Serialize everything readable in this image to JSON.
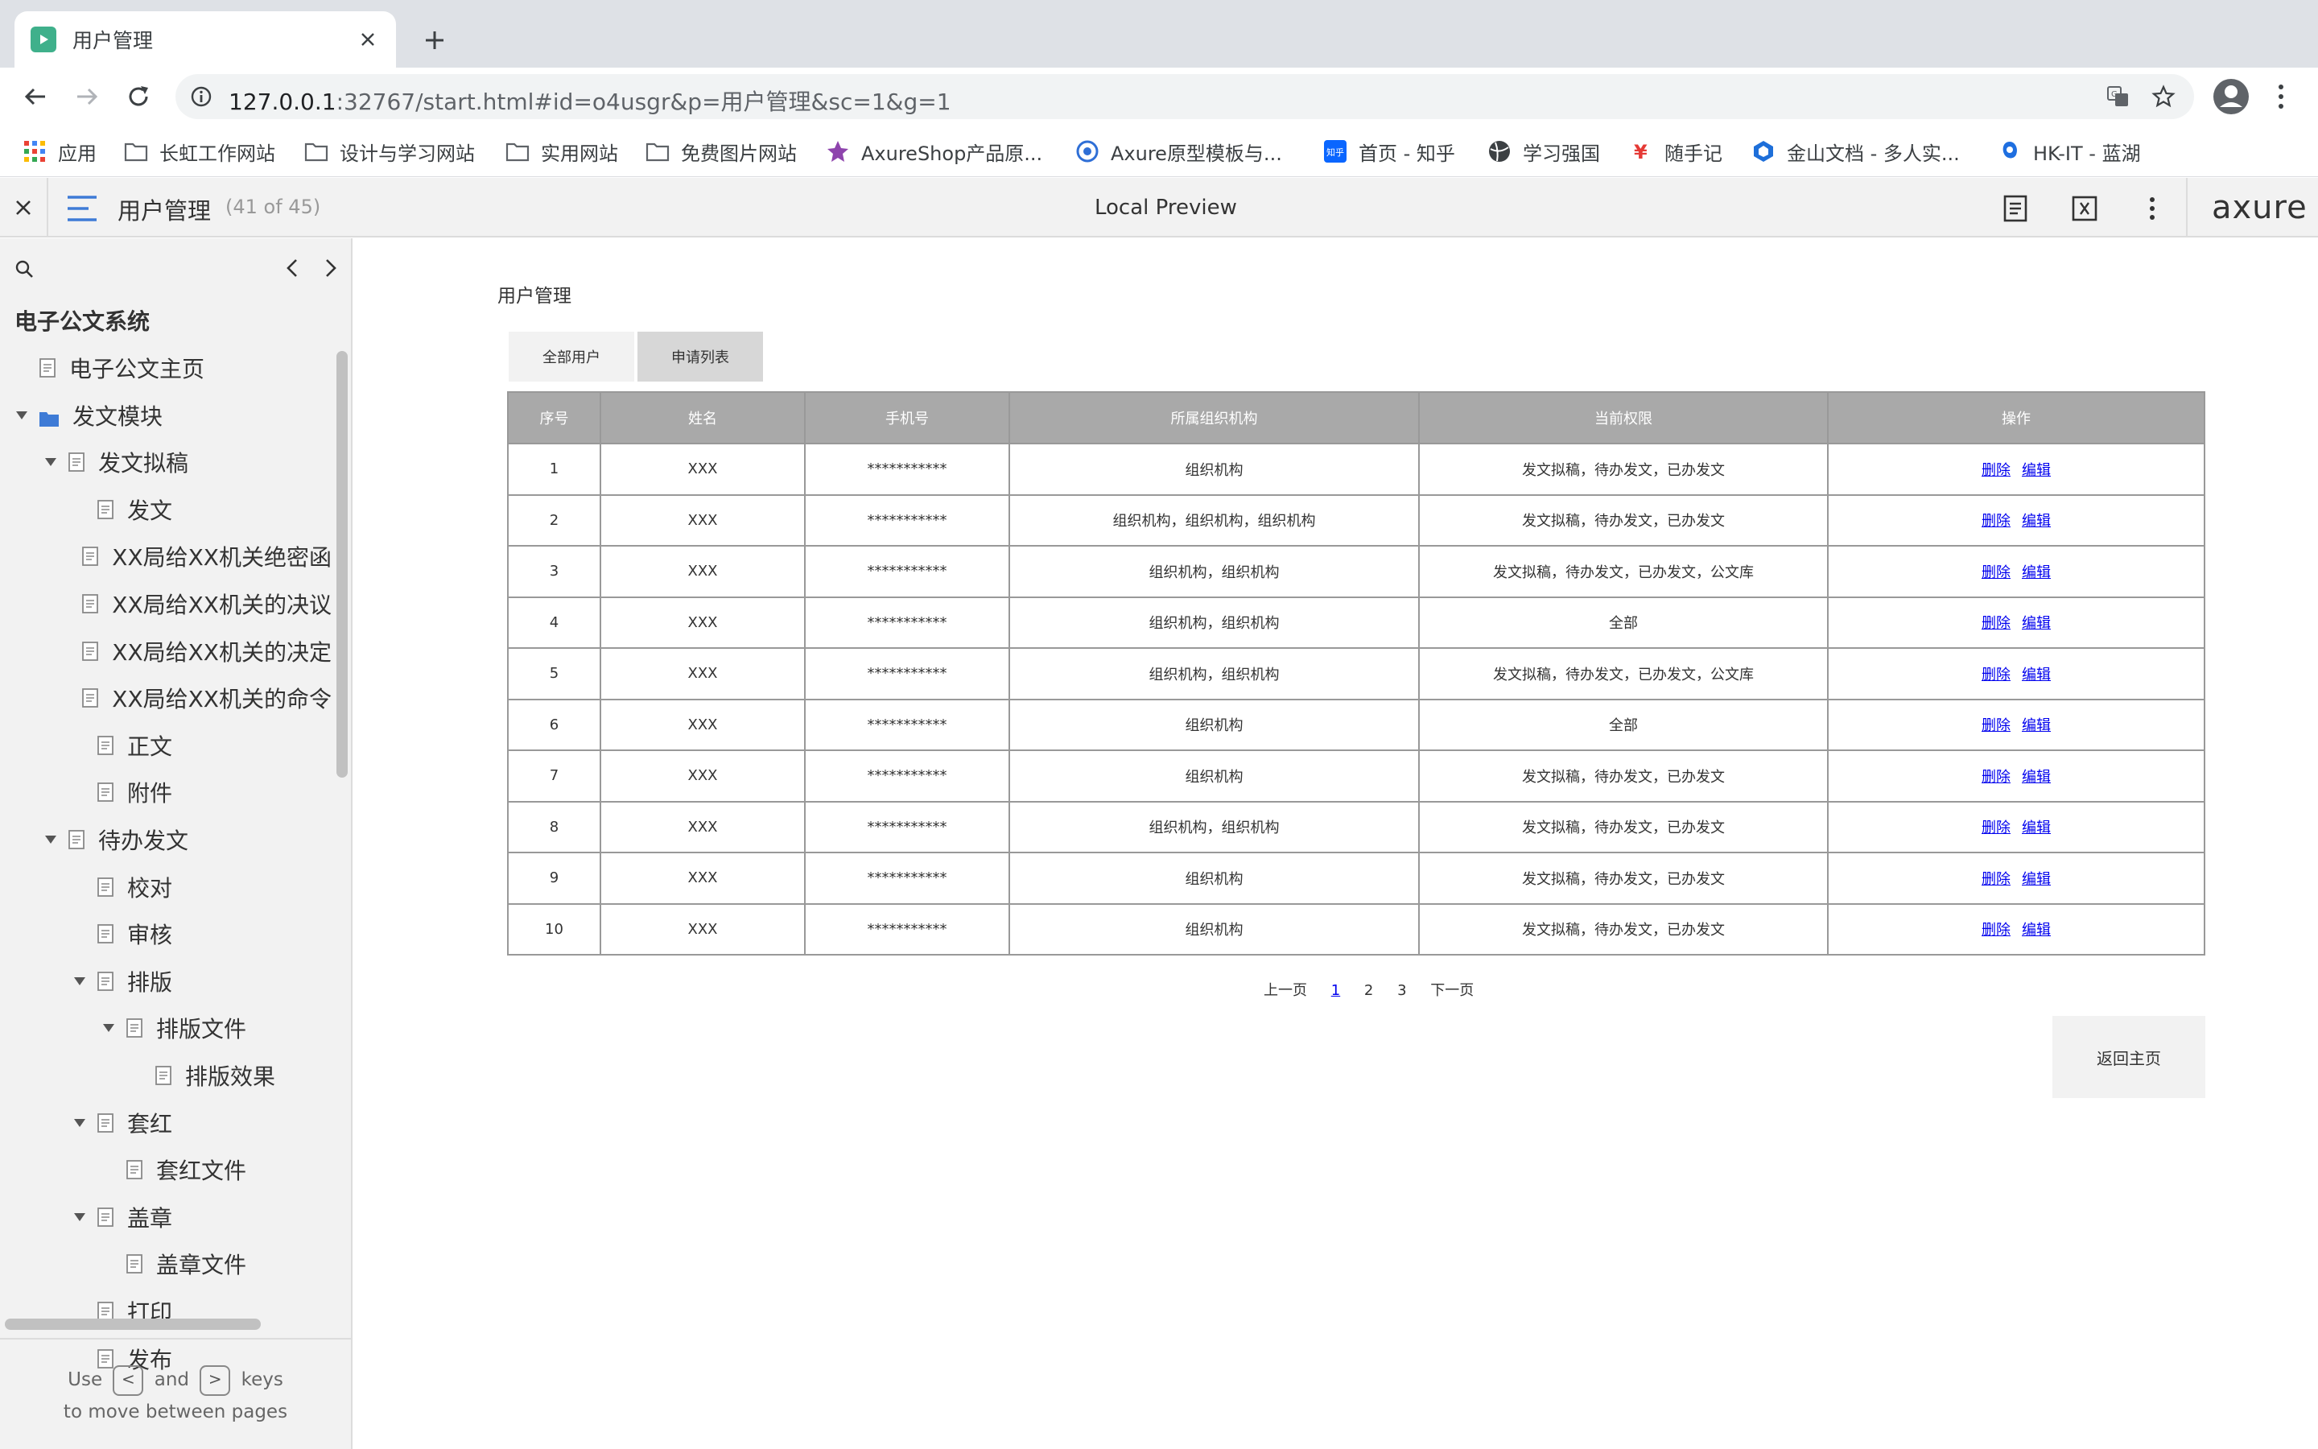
{
  "browser": {
    "tab_title": "用户管理",
    "url_host": "127.0.0.1",
    "url_rest": ":32767/start.html#id=o4usgr&p=用户管理&sc=1&g=1",
    "bookmarks": [
      "应用",
      "长虹工作网站",
      "设计与学习网站",
      "实用网站",
      "免费图片网站",
      "AxureShop产品原...",
      "Axure原型模板与...",
      "首页 - 知乎",
      "学习强国",
      "随手记",
      "金山文档 - 多人实...",
      "HK-IT - 蓝湖"
    ]
  },
  "axure": {
    "page_name": "用户管理",
    "page_count": "(41 of 45)",
    "preview_label": "Local Preview",
    "logo": "axure"
  },
  "sidebar": {
    "project": "电子公文系统",
    "tree": [
      {
        "label": "电子公文主页",
        "level": 0,
        "type": "page"
      },
      {
        "label": "发文模块",
        "level": 0,
        "type": "folder",
        "expanded": true
      },
      {
        "label": "发文拟稿",
        "level": 1,
        "type": "page",
        "expanded": true
      },
      {
        "label": "发文",
        "level": 2,
        "type": "page"
      },
      {
        "label": "XX局给XX机关绝密函",
        "level": 2,
        "type": "page"
      },
      {
        "label": "XX局给XX机关的决议",
        "level": 2,
        "type": "page"
      },
      {
        "label": "XX局给XX机关的决定",
        "level": 2,
        "type": "page"
      },
      {
        "label": "XX局给XX机关的命令",
        "level": 2,
        "type": "page"
      },
      {
        "label": "正文",
        "level": 2,
        "type": "page"
      },
      {
        "label": "附件",
        "level": 2,
        "type": "page"
      },
      {
        "label": "待办发文",
        "level": 1,
        "type": "page",
        "expanded": true
      },
      {
        "label": "校对",
        "level": 2,
        "type": "page"
      },
      {
        "label": "审核",
        "level": 2,
        "type": "page"
      },
      {
        "label": "排版",
        "level": 2,
        "type": "page",
        "expanded": true
      },
      {
        "label": "排版文件",
        "level": 3,
        "type": "page",
        "expanded": true
      },
      {
        "label": "排版效果",
        "level": 4,
        "type": "page"
      },
      {
        "label": "套红",
        "level": 2,
        "type": "page",
        "expanded": true
      },
      {
        "label": "套红文件",
        "level": 3,
        "type": "page"
      },
      {
        "label": "盖章",
        "level": 2,
        "type": "page",
        "expanded": true
      },
      {
        "label": "盖章文件",
        "level": 3,
        "type": "page"
      },
      {
        "label": "打印",
        "level": 2,
        "type": "page"
      },
      {
        "label": "发布",
        "level": 2,
        "type": "page"
      }
    ],
    "hint_use": "Use",
    "hint_and": "and",
    "hint_keys": "keys",
    "hint_line2": "to move between pages",
    "key_prev": "<",
    "key_next": ">"
  },
  "content": {
    "heading": "用户管理",
    "tabs": [
      "全部用户",
      "申请列表"
    ],
    "columns": [
      "序号",
      "姓名",
      "手机号",
      "所属组织机构",
      "当前权限",
      "操作"
    ],
    "rows": [
      [
        "1",
        "XXX",
        "***********",
        "组织机构",
        "发文拟稿，待办发文，已办发文"
      ],
      [
        "2",
        "XXX",
        "***********",
        "组织机构，组织机构，组织机构",
        "发文拟稿，待办发文，已办发文"
      ],
      [
        "3",
        "XXX",
        "***********",
        "组织机构，组织机构",
        "发文拟稿，待办发文，已办发文，公文库"
      ],
      [
        "4",
        "XXX",
        "***********",
        "组织机构，组织机构",
        "全部"
      ],
      [
        "5",
        "XXX",
        "***********",
        "组织机构，组织机构",
        "发文拟稿，待办发文，已办发文，公文库"
      ],
      [
        "6",
        "XXX",
        "***********",
        "组织机构",
        "全部"
      ],
      [
        "7",
        "XXX",
        "***********",
        "组织机构",
        "发文拟稿，待办发文，已办发文"
      ],
      [
        "8",
        "XXX",
        "***********",
        "组织机构，组织机构",
        "发文拟稿，待办发文，已办发文"
      ],
      [
        "9",
        "XXX",
        "***********",
        "组织机构",
        "发文拟稿，待办发文，已办发文"
      ],
      [
        "10",
        "XXX",
        "***********",
        "组织机构",
        "发文拟稿，待办发文，已办发文"
      ]
    ],
    "action_delete": "删除",
    "action_edit": "编辑",
    "pager": {
      "prev": "上一页",
      "pages": [
        "1",
        "2",
        "3"
      ],
      "current": "1",
      "next": "下一页"
    },
    "back_button": "返回主页"
  },
  "colors": {
    "table_header": "#a9a9a9",
    "link": "#0000ee",
    "panel": "#f2f2f2"
  }
}
